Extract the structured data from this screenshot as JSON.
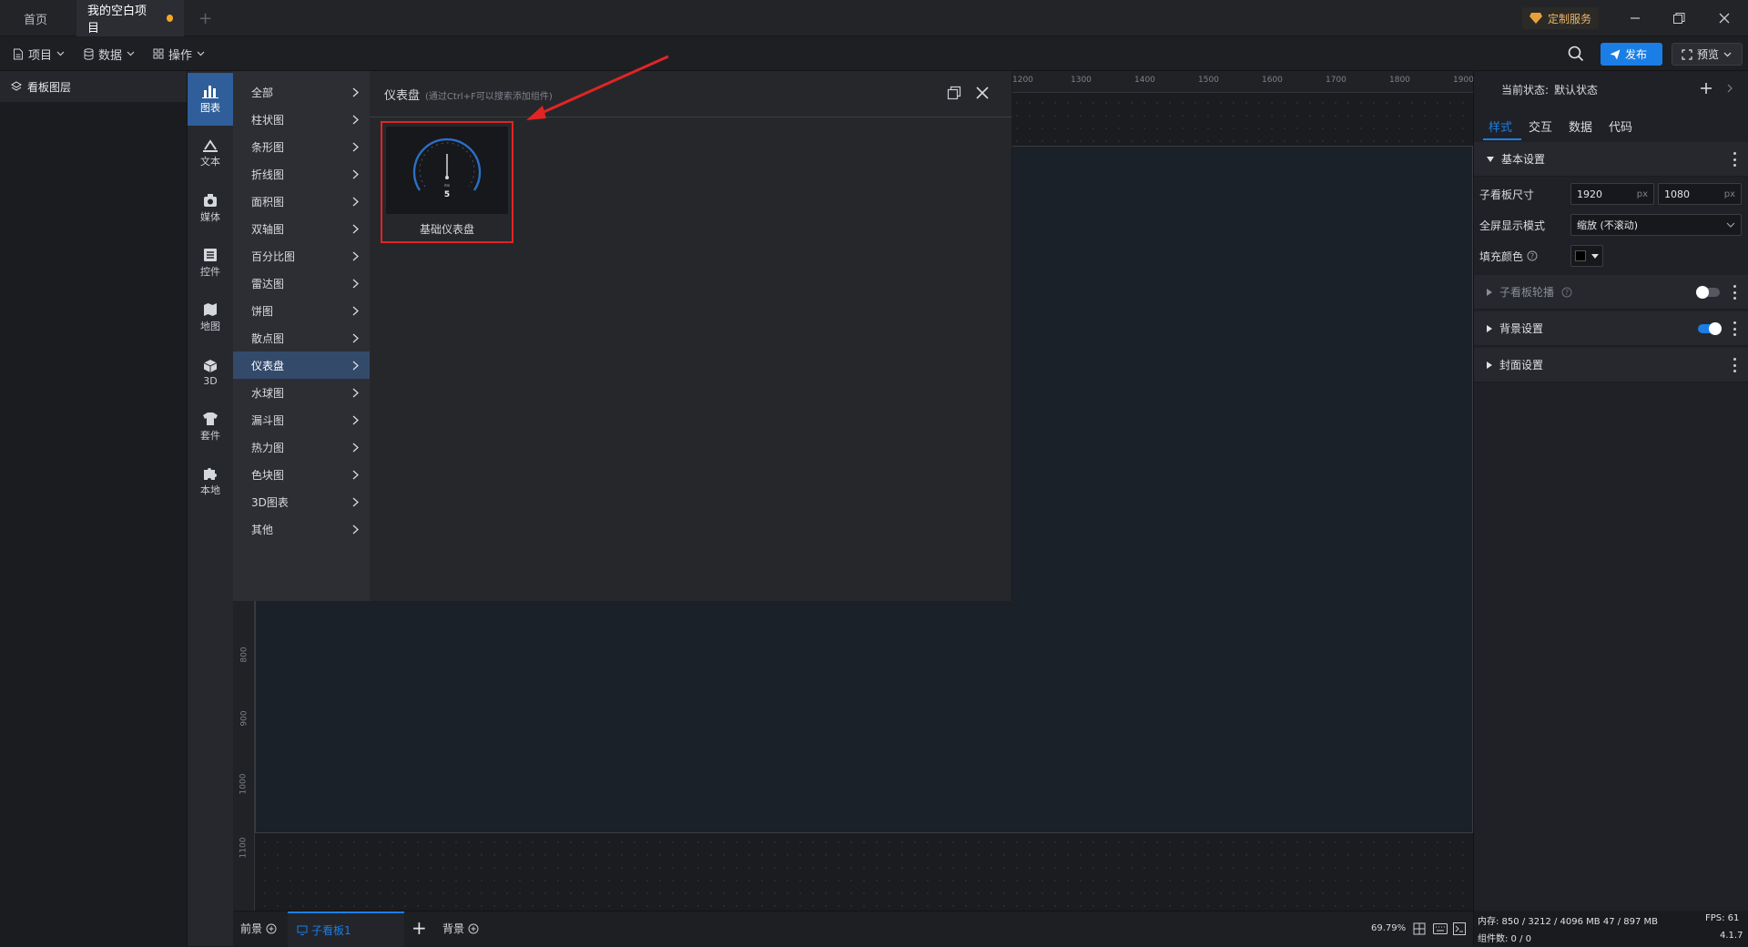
{
  "titlebar": {
    "tabs": [
      {
        "label": "首页"
      },
      {
        "label": "我的空白项目"
      }
    ],
    "add_tab": "+",
    "custom_service": "定制服务"
  },
  "toolbar": {
    "menus": [
      {
        "label": "项目",
        "icon": "file-icon"
      },
      {
        "label": "数据",
        "icon": "database-icon"
      },
      {
        "label": "操作",
        "icon": "grid-icon"
      }
    ],
    "publish": "发布",
    "preview": "预览"
  },
  "layers_panel": {
    "title": "看板图层"
  },
  "category_sidebar": [
    {
      "label": "图表",
      "icon": "bar-chart-icon",
      "active": true
    },
    {
      "label": "文本",
      "icon": "text-icon"
    },
    {
      "label": "媒体",
      "icon": "media-icon"
    },
    {
      "label": "控件",
      "icon": "control-icon"
    },
    {
      "label": "地图",
      "icon": "map-icon"
    },
    {
      "label": "3D",
      "icon": "cube-icon"
    },
    {
      "label": "套件",
      "icon": "kit-icon"
    },
    {
      "label": "本地",
      "icon": "puzzle-icon"
    }
  ],
  "submenu": [
    "全部",
    "柱状图",
    "条形图",
    "折线图",
    "面积图",
    "双轴图",
    "百分比图",
    "雷达图",
    "饼图",
    "散点图",
    "仪表盘",
    "水球图",
    "漏斗图",
    "热力图",
    "色块图",
    "3D图表",
    "其他"
  ],
  "submenu_active": "仪表盘",
  "component_panel": {
    "title": "仪表盘",
    "hint": "(通过Ctrl+F可以搜索添加组件)",
    "items": [
      {
        "label": "基础仪表盘",
        "gauge_value": "5"
      }
    ]
  },
  "ruler": {
    "top": [
      "1200",
      "1300",
      "1400",
      "1500",
      "1600",
      "1700",
      "1800",
      "1900"
    ],
    "left": [
      "800",
      "900",
      "1000",
      "1100"
    ]
  },
  "right_panel": {
    "state_label": "当前状态:",
    "state_value": "默认状态",
    "tabs": [
      "样式",
      "交互",
      "数据",
      "代码"
    ],
    "basic_section": "基本设置",
    "size_label": "子看板尺寸",
    "width": "1920",
    "height": "1080",
    "unit": "px",
    "fullscreen_label": "全屏显示模式",
    "fullscreen_value": "缩放 (不滚动)",
    "fill_label": "填充颜色",
    "fill_color": "#000000",
    "carousel_section": "子看板轮播",
    "carousel_on": false,
    "background_section": "背景设置",
    "background_on": true,
    "cover_section": "封面设置"
  },
  "bottombar": {
    "foreground": "前景",
    "board": "子看板1",
    "add": "+",
    "background": "背景",
    "zoom": "69.79%"
  },
  "status": {
    "memory": "内存: 850 / 3212 / 4096 MB 47 / 897 MB",
    "fps": "FPS: 61",
    "components": "组件数: 0 / 0",
    "version": "4.1.7"
  },
  "colors": {
    "accent": "#1a7ee6",
    "active_category": "#2f5e9a",
    "highlight_box": "#e02525",
    "tab_dot": "#f5a623"
  }
}
